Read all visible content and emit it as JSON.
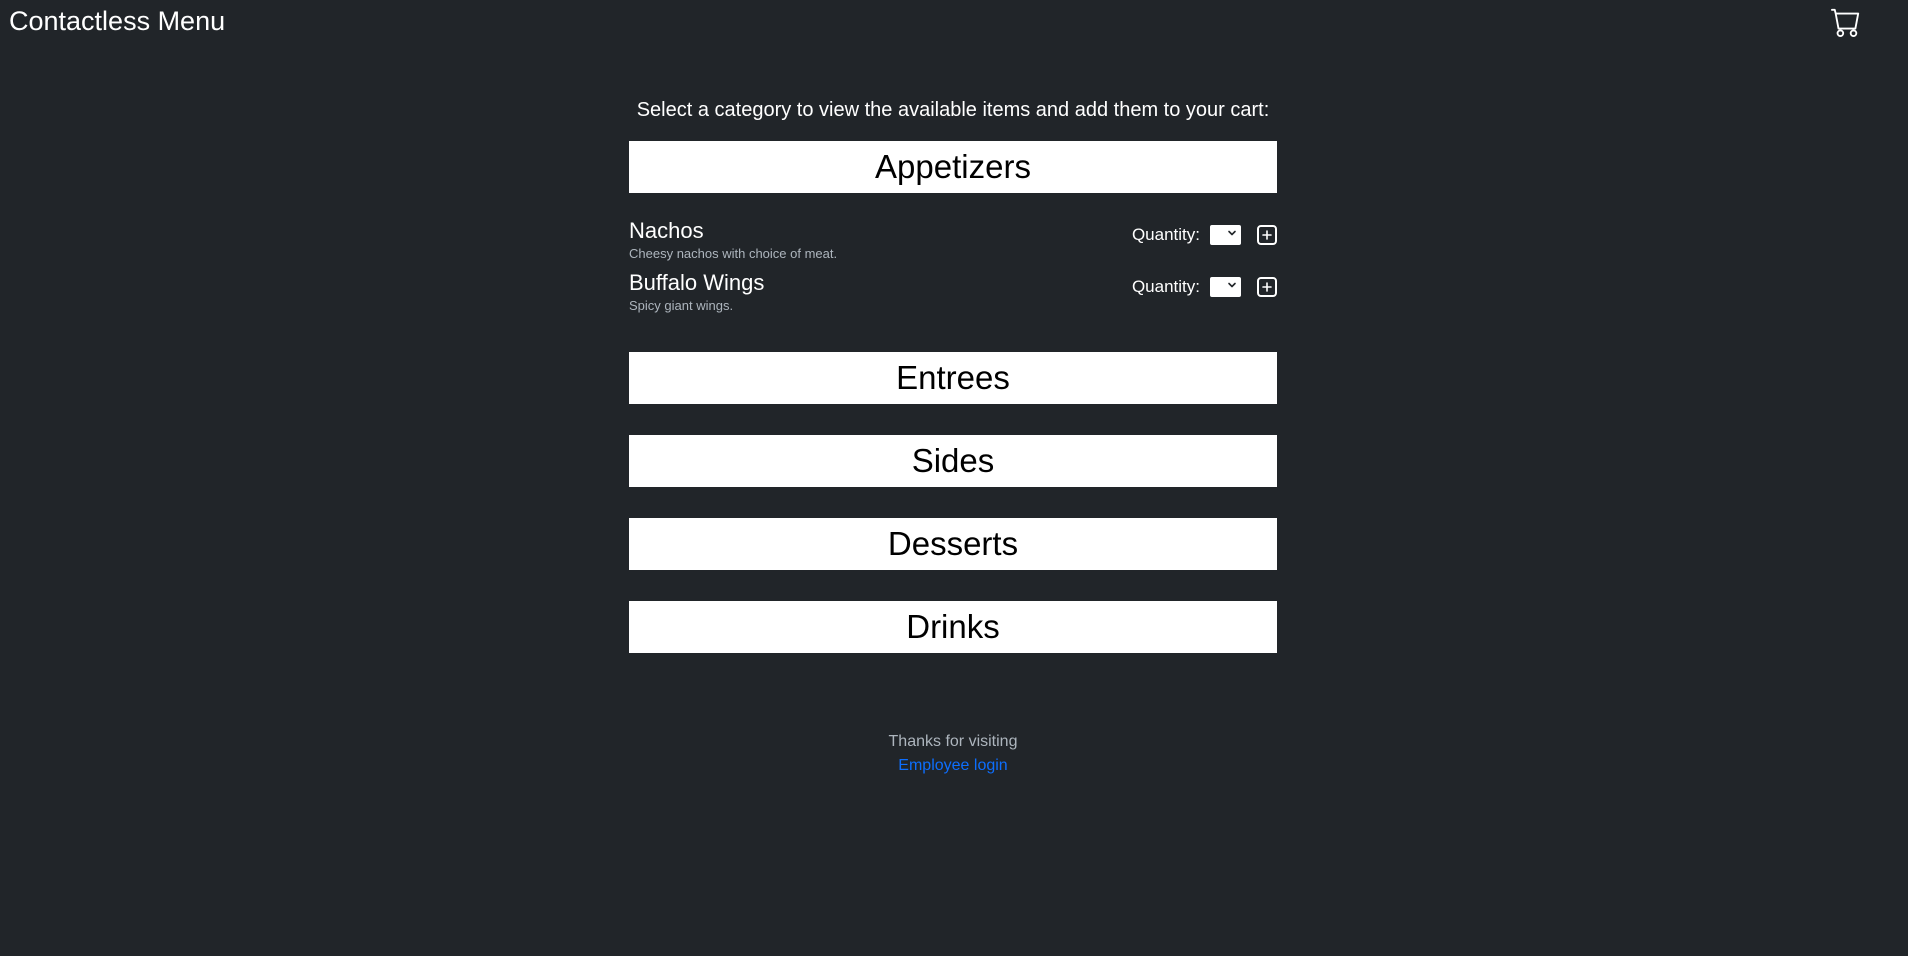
{
  "navbar": {
    "brand": "Contactless Menu",
    "cart_icon": "cart-icon"
  },
  "main": {
    "instructions": "Select a category to view the available items and add them to your cart:",
    "categories": [
      {
        "label": "Appetizers",
        "expanded": true,
        "items": [
          {
            "name": "Nachos",
            "description": "Cheesy nachos with choice of meat.",
            "quantity_label": "Quantity:",
            "quantity_value": ""
          },
          {
            "name": "Buffalo Wings",
            "description": "Spicy giant wings.",
            "quantity_label": "Quantity:",
            "quantity_value": ""
          }
        ]
      },
      {
        "label": "Entrees",
        "expanded": false
      },
      {
        "label": "Sides",
        "expanded": false
      },
      {
        "label": "Desserts",
        "expanded": false
      },
      {
        "label": "Drinks",
        "expanded": false
      }
    ]
  },
  "footer": {
    "thanks": "Thanks for visiting",
    "login_link": "Employee login"
  },
  "colors": {
    "background": "#212529",
    "link": "#0d6efd",
    "muted": "#adb5bd"
  }
}
